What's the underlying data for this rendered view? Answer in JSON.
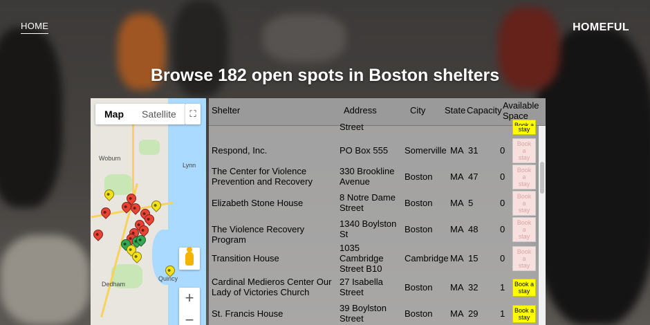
{
  "nav": {
    "home_label": "HOME",
    "brand": "HOMEFUL"
  },
  "page": {
    "title": "Browse 182 open spots in Boston shelters"
  },
  "map": {
    "tab_map": "Map",
    "tab_satellite": "Satellite",
    "zoom_in": "+",
    "zoom_out": "−",
    "labels": [
      "Woburn",
      "Lynn",
      "Quincy",
      "Dedham"
    ]
  },
  "colors": {
    "book_available": "#ffff00",
    "book_unavailable": "#f8e0df",
    "pin_red": "#e94335",
    "pin_green": "#34a853",
    "pin_yellow": "#f2e11b"
  },
  "table": {
    "headers": {
      "shelter": "Shelter",
      "address": "Address",
      "city": "City",
      "state": "State",
      "capacity": "Capacity",
      "available_line1": "Available",
      "available_line2": "Space"
    },
    "partial_row": {
      "address": "Street",
      "book": [
        "Book a",
        "stay"
      ]
    },
    "rows": [
      {
        "shelter": [
          "Respond, Inc."
        ],
        "address": [
          "PO Box 555"
        ],
        "city": "Somerville",
        "state": "MA",
        "capacity": "31",
        "available": "0",
        "book": [
          "Book",
          "a",
          "stay"
        ],
        "bookable": false
      },
      {
        "shelter": [
          "The Center for Violence",
          "Prevention and Recovery"
        ],
        "address": [
          "330 Brookline",
          "Avenue"
        ],
        "city": "Boston",
        "state": "MA",
        "capacity": "47",
        "available": "0",
        "book": [
          "Book",
          "a",
          "stay"
        ],
        "bookable": false
      },
      {
        "shelter": [
          "Elizabeth Stone House"
        ],
        "address": [
          "8 Notre Dame",
          "Street"
        ],
        "city": "Boston",
        "state": "MA",
        "capacity": "5",
        "available": "0",
        "book": [
          "Book",
          "a",
          "stay"
        ],
        "bookable": false
      },
      {
        "shelter": [
          "The Violence Recovery Program"
        ],
        "address": [
          "1340 Boylston",
          "St"
        ],
        "city": "Boston",
        "state": "MA",
        "capacity": "48",
        "available": "0",
        "book": [
          "Book",
          "a",
          "stay"
        ],
        "bookable": false
      },
      {
        "shelter": [
          "Transition House"
        ],
        "address": [
          "1035",
          "Cambridge",
          "Street B10"
        ],
        "city": "Cambridge",
        "state": "MA",
        "capacity": "15",
        "available": "0",
        "book": [
          "Book",
          "a",
          "stay"
        ],
        "bookable": false
      },
      {
        "shelter": [
          "Cardinal Medieros Center Our",
          "Lady of Victories Church"
        ],
        "address": [
          "27 Isabella",
          "Street"
        ],
        "city": "Boston",
        "state": "MA",
        "capacity": "32",
        "available": "1",
        "book": [
          "Book a",
          "stay"
        ],
        "bookable": true
      },
      {
        "shelter": [
          "St. Francis House"
        ],
        "address": [
          "39 Boylston",
          "Street"
        ],
        "city": "Boston",
        "state": "MA",
        "capacity": "29",
        "available": "1",
        "book": [
          "Book a",
          "stay"
        ],
        "bookable": true
      }
    ]
  }
}
